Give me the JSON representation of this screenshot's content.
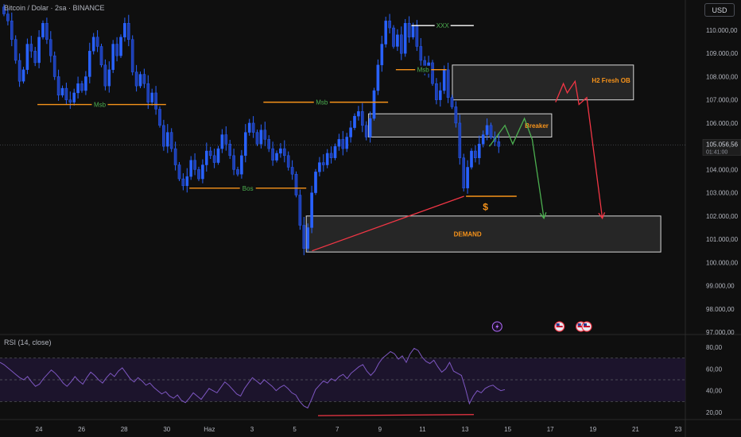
{
  "header": {
    "symbol_line": "Bitcoin / Dolar · 2sa · BINANCE",
    "currency": "USD"
  },
  "colors": {
    "background": "#0f0f0f",
    "candle": "#2962ff",
    "level": "#f7931a",
    "zone_fill": "#3a3a3a",
    "zone_border": "#d8d8d8",
    "projection_green": "#4caf50",
    "projection_red": "#f23645",
    "trendline": "#f23645",
    "rsi_line": "#7e57c2",
    "rsi_band": "#1e1530"
  },
  "chart_data": [
    {
      "type": "candlestick",
      "symbol": "Bitcoin / Dolar",
      "timeframe": "2sa",
      "exchange": "BINANCE",
      "ylim": [
        97000,
        111000
      ],
      "y_ticks": [
        "110.000,00",
        "109.000,00",
        "108.000,00",
        "107.000,00",
        "106.000,00",
        "104.000,00",
        "103.000,00",
        "102.000,00",
        "101.000,00",
        "100.000,00",
        "99.000,00",
        "98.000,00",
        "97.000,00"
      ],
      "y_tick_values": [
        110000,
        109000,
        108000,
        107000,
        106000,
        104000,
        103000,
        102000,
        101000,
        100000,
        99000,
        98000,
        97000
      ],
      "x_ticks": [
        "24",
        "26",
        "28",
        "30",
        "Haz",
        "3",
        "5",
        "7",
        "9",
        "11",
        "13",
        "15",
        "17",
        "19",
        "21",
        "23"
      ],
      "last_price": {
        "label": "105.056,56",
        "countdown": "01:41:00",
        "value": 105056.56
      },
      "price_path": [
        [
          0,
          111000
        ],
        [
          2,
          110400
        ],
        [
          3,
          109600
        ],
        [
          4,
          108700
        ],
        [
          5,
          107800
        ],
        [
          6,
          108300
        ],
        [
          7,
          109400
        ],
        [
          8,
          109100
        ],
        [
          9,
          108600
        ],
        [
          10,
          109700
        ],
        [
          11,
          110300
        ],
        [
          12,
          109600
        ],
        [
          13,
          108900
        ],
        [
          14,
          108000
        ],
        [
          15,
          107200
        ],
        [
          16,
          107500
        ],
        [
          17,
          107000
        ],
        [
          18,
          106900
        ],
        [
          19,
          107300
        ],
        [
          20,
          107700
        ],
        [
          21,
          107400
        ],
        [
          22,
          108000
        ],
        [
          23,
          109100
        ],
        [
          24,
          109700
        ],
        [
          25,
          109300
        ],
        [
          26,
          108500
        ],
        [
          27,
          107600
        ],
        [
          28,
          108300
        ],
        [
          29,
          109400
        ],
        [
          30,
          108900
        ],
        [
          31,
          109700
        ],
        [
          32,
          110300
        ],
        [
          33,
          109600
        ],
        [
          34,
          108200
        ],
        [
          35,
          107600
        ],
        [
          36,
          108100
        ],
        [
          37,
          107700
        ],
        [
          38,
          106900
        ],
        [
          39,
          107300
        ],
        [
          40,
          106600
        ],
        [
          41,
          105900
        ],
        [
          42,
          105000
        ],
        [
          43,
          105600
        ],
        [
          44,
          104900
        ],
        [
          45,
          104200
        ],
        [
          46,
          103600
        ],
        [
          47,
          103300
        ],
        [
          48,
          103700
        ],
        [
          49,
          104400
        ],
        [
          50,
          104000
        ],
        [
          51,
          103600
        ],
        [
          52,
          104200
        ],
        [
          53,
          104800
        ],
        [
          54,
          104600
        ],
        [
          55,
          104300
        ],
        [
          56,
          104900
        ],
        [
          57,
          105500
        ],
        [
          58,
          105100
        ],
        [
          59,
          104600
        ],
        [
          60,
          104000
        ],
        [
          61,
          103800
        ],
        [
          62,
          104600
        ],
        [
          63,
          105600
        ],
        [
          64,
          106000
        ],
        [
          65,
          105600
        ],
        [
          66,
          105100
        ],
        [
          67,
          105700
        ],
        [
          68,
          105300
        ],
        [
          69,
          104900
        ],
        [
          70,
          104400
        ],
        [
          71,
          104700
        ],
        [
          72,
          104900
        ],
        [
          73,
          104600
        ],
        [
          74,
          104100
        ],
        [
          75,
          103800
        ],
        [
          76,
          102900
        ],
        [
          77,
          101600
        ],
        [
          78,
          100600
        ],
        [
          79,
          101500
        ],
        [
          80,
          103000
        ],
        [
          81,
          103900
        ],
        [
          82,
          104300
        ],
        [
          83,
          104200
        ],
        [
          84,
          104700
        ],
        [
          85,
          104500
        ],
        [
          86,
          105000
        ],
        [
          87,
          105300
        ],
        [
          88,
          104900
        ],
        [
          89,
          105400
        ],
        [
          90,
          105800
        ],
        [
          91,
          106300
        ],
        [
          92,
          106500
        ],
        [
          93,
          105900
        ],
        [
          94,
          105400
        ],
        [
          95,
          106200
        ],
        [
          96,
          107400
        ],
        [
          97,
          108500
        ],
        [
          98,
          109400
        ],
        [
          99,
          110400
        ],
        [
          100,
          110100
        ],
        [
          101,
          109300
        ],
        [
          102,
          109800
        ],
        [
          103,
          109000
        ],
        [
          104,
          110300
        ],
        [
          105,
          109700
        ],
        [
          106,
          110200
        ],
        [
          107,
          109300
        ],
        [
          108,
          108700
        ],
        [
          109,
          108200
        ],
        [
          110,
          108600
        ],
        [
          111,
          107700
        ],
        [
          112,
          107000
        ],
        [
          113,
          107400
        ],
        [
          114,
          108300
        ],
        [
          115,
          107100
        ],
        [
          116,
          106700
        ],
        [
          117,
          106000
        ],
        [
          118,
          104500
        ],
        [
          119,
          103200
        ],
        [
          120,
          104100
        ],
        [
          121,
          104800
        ],
        [
          122,
          104500
        ],
        [
          123,
          105100
        ],
        [
          124,
          105500
        ],
        [
          125,
          105900
        ],
        [
          126,
          105400
        ],
        [
          127,
          105200
        ],
        [
          128,
          105000
        ]
      ],
      "annotations": {
        "levels": [
          {
            "label": "Msb",
            "price": 106800,
            "from": 9,
            "to": 42,
            "label_at": 25,
            "color": "#f7931a",
            "label_color": "#4caf50"
          },
          {
            "label": "Bos",
            "price": 103200,
            "from": 48,
            "to": 78,
            "label_at": 63,
            "color": "#f7931a",
            "label_color": "#4caf50"
          },
          {
            "label": "Msb",
            "price": 106900,
            "from": 67,
            "to": 99,
            "label_at": 82,
            "color": "#f7931a",
            "label_color": "#4caf50"
          },
          {
            "label": "Msb",
            "price": 108300,
            "from": 101,
            "to": 114,
            "label_at": 108,
            "color": "#f7931a",
            "label_color": "#4caf50"
          },
          {
            "label": "XXX",
            "price": 110200,
            "from": 105,
            "to": 121,
            "label_at": 113,
            "color": "#ffffff",
            "label_color": "#4caf50"
          },
          {
            "label": "",
            "price": 102850,
            "from": 119,
            "to": 132,
            "label_at": 0,
            "color": "#f7931a",
            "label_color": "#f7931a"
          }
        ],
        "dollar_marker": {
          "label": "$",
          "x": 124,
          "price": 102450
        },
        "zones": [
          {
            "label": "H2 Fresh OB",
            "top": 108500,
            "bottom": 107000,
            "from": 115.5,
            "to": 162
          },
          {
            "label": "Breaker",
            "top": 106400,
            "bottom": 105400,
            "from": 94,
            "to": 141
          },
          {
            "label": "DEMAND",
            "top": 102000,
            "bottom": 100450,
            "from": 78,
            "to": 169
          }
        ],
        "trendline": {
          "from": [
            79.5,
            100500
          ],
          "to": [
            118.5,
            102850
          ]
        },
        "green_path": [
          [
            125,
            105000
          ],
          [
            129,
            105900
          ],
          [
            131,
            105100
          ],
          [
            134,
            106200
          ],
          [
            136,
            105300
          ],
          [
            139,
            101900
          ]
        ],
        "red_path": [
          [
            142,
            106900
          ],
          [
            144,
            107700
          ],
          [
            145,
            107300
          ],
          [
            147,
            107800
          ],
          [
            148,
            106800
          ],
          [
            150,
            107100
          ],
          [
            154,
            101900
          ]
        ],
        "event_icons": [
          {
            "x": 127,
            "kind": "lightning-icon"
          },
          {
            "x": 143,
            "kind": "flag-icon"
          },
          {
            "x": 148.5,
            "kind": "flag-icon"
          },
          {
            "x": 150,
            "kind": "flag-icon"
          }
        ]
      }
    },
    {
      "type": "line",
      "title": "RSI (14, close)",
      "ylim": [
        15,
        85
      ],
      "y_ticks": [
        "80,00",
        "60,00",
        "40,00",
        "20,00"
      ],
      "y_tick_values": [
        80,
        60,
        40,
        20
      ],
      "bands": [
        70,
        50,
        30
      ],
      "values": [
        66,
        64,
        61,
        58,
        55,
        52,
        50,
        53,
        48,
        44,
        46,
        51,
        55,
        59,
        56,
        52,
        47,
        44,
        48,
        53,
        49,
        46,
        52,
        57,
        54,
        50,
        47,
        52,
        56,
        53,
        58,
        61,
        56,
        51,
        48,
        52,
        49,
        45,
        47,
        43,
        40,
        37,
        39,
        35,
        33,
        36,
        31,
        29,
        33,
        38,
        35,
        32,
        37,
        42,
        40,
        38,
        43,
        48,
        45,
        41,
        37,
        35,
        42,
        47,
        52,
        49,
        46,
        50,
        47,
        44,
        40,
        43,
        45,
        42,
        38,
        36,
        30,
        26,
        24,
        32,
        41,
        45,
        49,
        47,
        51,
        49,
        53,
        55,
        51,
        56,
        59,
        62,
        64,
        58,
        54,
        58,
        65,
        70,
        73,
        76,
        74,
        69,
        72,
        66,
        74,
        79,
        77,
        71,
        67,
        65,
        68,
        62,
        57,
        60,
        66,
        58,
        56,
        54,
        42,
        28,
        35,
        40,
        38,
        42,
        44,
        45,
        42,
        40,
        41
      ]
    }
  ]
}
